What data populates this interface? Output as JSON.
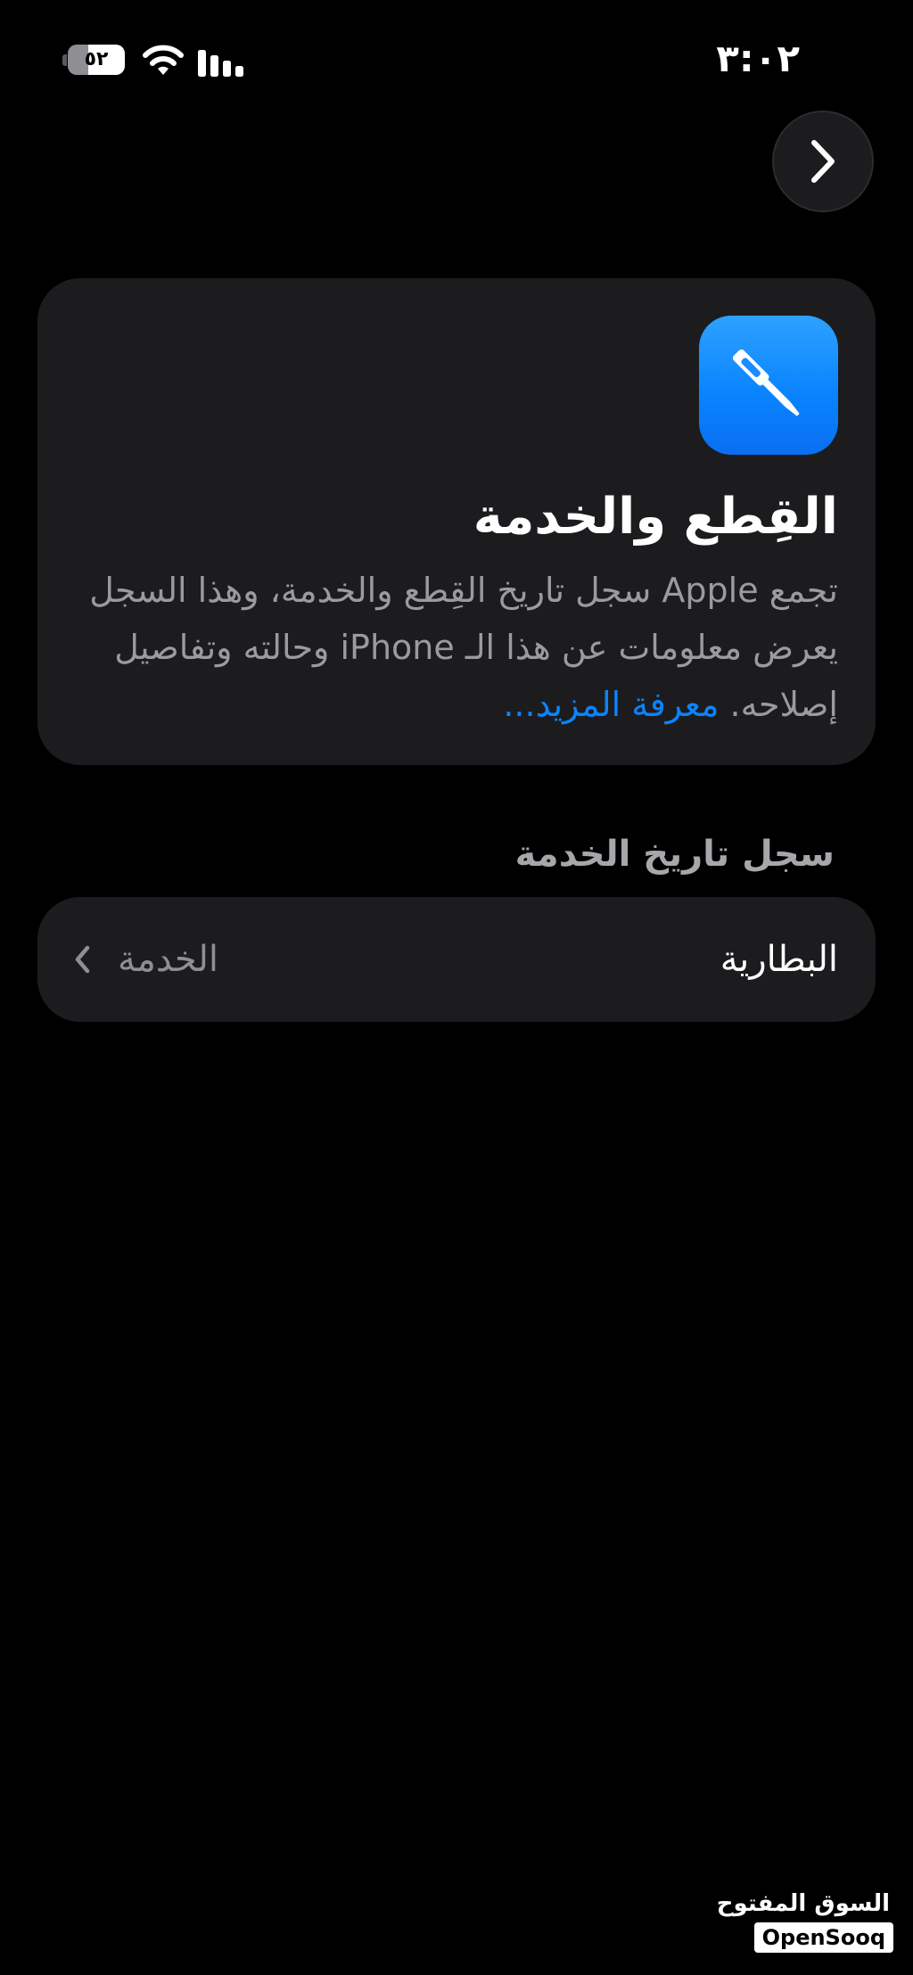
{
  "status_bar": {
    "time": "٣:٠٢",
    "battery_level": "٥٢",
    "battery_fraction": 0.52,
    "wifi_icon": "wifi-icon",
    "signal_icon": "cellular-signal-icon"
  },
  "navigation": {
    "forward_icon": "chevron-right-icon"
  },
  "info_card": {
    "icon": "screwdriver-icon",
    "title": "القِطع والخدمة",
    "description": "تجمع Apple سجل تاريخ القِطع والخدمة، وهذا السجل يعرض معلومات عن هذا الـ iPhone وحالته وتفاصيل إصلاحه.",
    "learn_more_label": "معرفة المزيد..."
  },
  "service_history": {
    "header": "سجل تاريخ الخدمة",
    "rows": [
      {
        "label": "البطارية",
        "value": "الخدمة",
        "chevron_icon": "chevron-left-icon"
      }
    ]
  },
  "watermark": {
    "arabic": "السوق المفتوح",
    "latin": "OpenSooq"
  },
  "colors": {
    "background": "#000000",
    "card": "#1c1c1e",
    "accent": "#0a84ff",
    "secondary_text": "#9a9aa0"
  }
}
